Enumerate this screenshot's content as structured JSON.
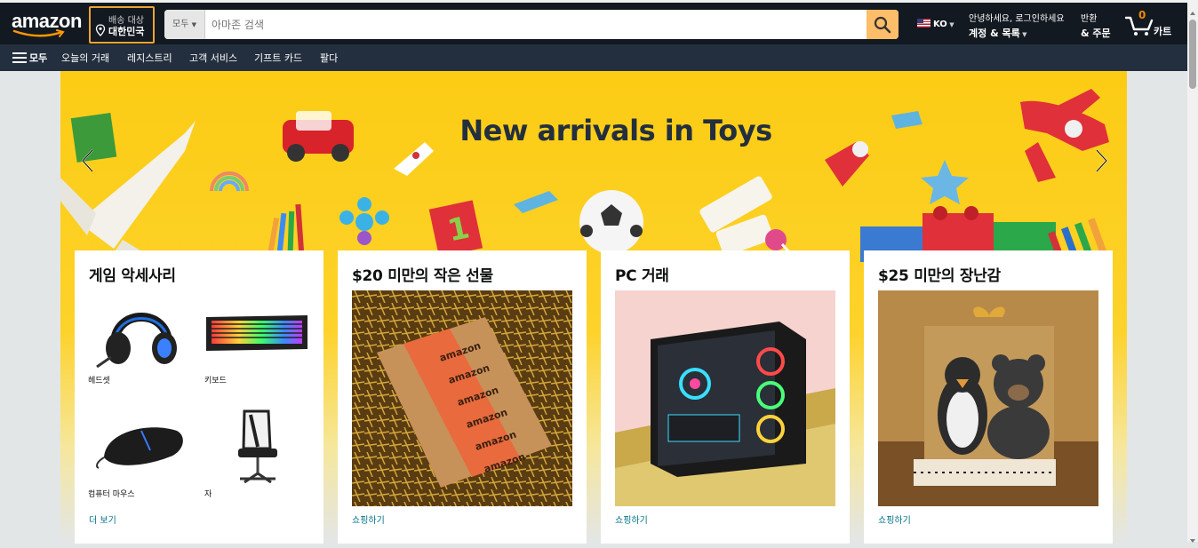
{
  "header": {
    "logo": "amazon",
    "deliver_to": {
      "line1": "배송 대상",
      "line2": "대한민국"
    },
    "search": {
      "category": "모두",
      "placeholder": "아마존 검색"
    },
    "language": "KO",
    "account": {
      "line1": "안녕하세요, 로그인하세요",
      "line2": "계정 & 목록"
    },
    "orders": {
      "line1": "반환",
      "line2": "& 주문"
    },
    "cart": {
      "count": "0",
      "label": "카트"
    }
  },
  "subnav": {
    "all": "모두",
    "items": [
      "오늘의 거래",
      "레지스트리",
      "고객 서비스",
      "기프트 카드",
      "팔다"
    ]
  },
  "hero": {
    "title": "New arrivals in Toys"
  },
  "cards": [
    {
      "title": "게임 악세사리",
      "items": [
        {
          "label": "헤드셋",
          "icon": "headset-image"
        },
        {
          "label": "키보드",
          "icon": "keyboard-image"
        },
        {
          "label": "컴퓨터 마우스",
          "icon": "mouse-image"
        },
        {
          "label": "자",
          "icon": "chair-image"
        }
      ],
      "link": "더 보기"
    },
    {
      "title": "$20 미만의 작은 선물",
      "image": "amazon-box-image",
      "link": "쇼핑하기"
    },
    {
      "title": "PC 거래",
      "image": "pc-case-image",
      "link": "쇼핑하기"
    },
    {
      "title": "$25 미만의 장난감",
      "image": "plush-toys-image",
      "link": "쇼핑하기"
    }
  ],
  "colors": {
    "nav_dark": "#131921",
    "nav_sub": "#232f3e",
    "search_button": "#febd69",
    "hero_yellow": "#fccc14",
    "link": "#007185",
    "cart_count": "#f08804"
  }
}
